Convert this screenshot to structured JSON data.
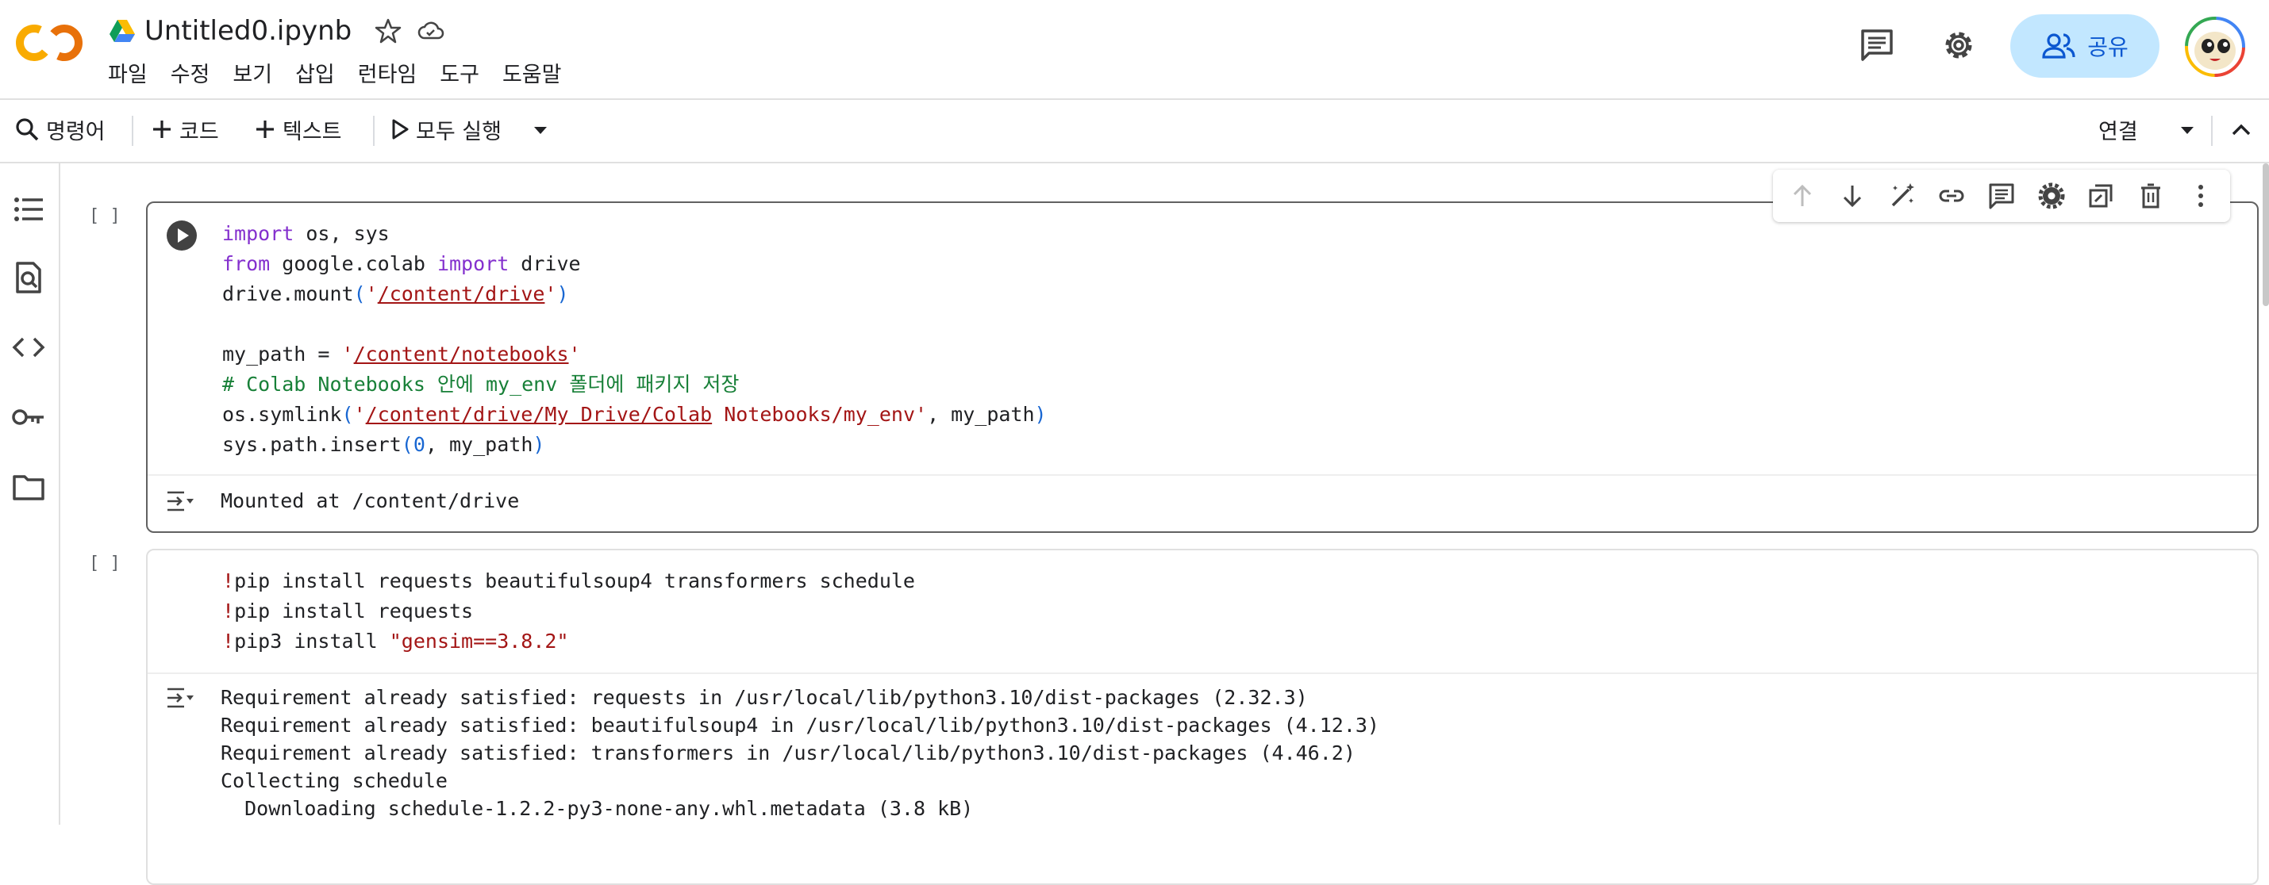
{
  "header": {
    "notebook_title": "Untitled0.ipynb",
    "menu": [
      "파일",
      "수정",
      "보기",
      "삽입",
      "런타임",
      "도구",
      "도움말"
    ],
    "share_label": "공유"
  },
  "toolbar": {
    "command_label": "명령어",
    "add_code_label": "코드",
    "add_text_label": "텍스트",
    "run_all_label": "모두 실행",
    "connect_label": "연결"
  },
  "cells": [
    {
      "bracket": "[ ]",
      "output": "Mounted at /content/drive"
    },
    {
      "bracket": "[ ]",
      "output": [
        "Requirement already satisfied: requests in /usr/local/lib/python3.10/dist-packages (2.32.3)",
        "Requirement already satisfied: beautifulsoup4 in /usr/local/lib/python3.10/dist-packages (4.12.3)",
        "Requirement already satisfied: transformers in /usr/local/lib/python3.10/dist-packages (4.46.2)",
        "Collecting schedule",
        "  Downloading schedule-1.2.2-py3-none-any.whl.metadata (3.8 kB)"
      ]
    }
  ],
  "code_tokens": {
    "c1l1_kw": "import",
    "c1l1_rest": " os, sys",
    "c1l2_kw1": "from",
    "c1l2_mid": " google.colab ",
    "c1l2_kw2": "import",
    "c1l2_rest": " drive",
    "c1l3_a": "drive.mount",
    "c1l3_p1": "(",
    "c1l3_q1": "'",
    "c1l3_path": "/content/drive",
    "c1l3_q2": "'",
    "c1l3_p2": ")",
    "c1l5_a": "my_path = ",
    "c1l5_q1": "'",
    "c1l5_path": "/content/notebooks",
    "c1l5_q2": "'",
    "c1l6_cmt": "# Colab Notebooks 안에 my_env 폴더에 패키지 저장",
    "c1l7_a": "os.symlink",
    "c1l7_p1": "(",
    "c1l7_q1": "'",
    "c1l7_path": "/content/drive/My Drive/Colab",
    "c1l7_rest": " Notebooks/my_env'",
    "c1l7_b": ", my_path",
    "c1l7_p2": ")",
    "c1l8_a": "sys.path.insert",
    "c1l8_p1": "(",
    "c1l8_num": "0",
    "c1l8_b": ", my_path",
    "c1l8_p2": ")",
    "c2l1_bang": "!",
    "c2l1_rest": "pip install requests beautifulsoup4 transformers schedule",
    "c2l2_bang": "!",
    "c2l2_rest": "pip install requests",
    "c2l3_bang": "!",
    "c2l3_rest": "pip3 install ",
    "c2l3_str": "\"gensim==3.8.2\""
  },
  "colors": {
    "accent_blue": "#0b57d0",
    "share_bg": "#c2e7ff",
    "logo_orange": "#f9ab00",
    "keyword_purple": "#8430ce",
    "string_red": "#a31515",
    "comment_green": "#188038"
  },
  "icons": {
    "header": [
      "comment-icon",
      "settings-icon",
      "people-icon"
    ],
    "rail": [
      "toc-icon",
      "find-icon",
      "code-snippets-icon",
      "secrets-key-icon",
      "folder-icon"
    ],
    "cell_toolbar": [
      "arrow-up-icon",
      "arrow-down-icon",
      "edit-magic-icon",
      "link-icon",
      "comment-icon",
      "gear-icon",
      "mirror-cell-icon",
      "delete-icon",
      "more-vert-icon"
    ]
  }
}
